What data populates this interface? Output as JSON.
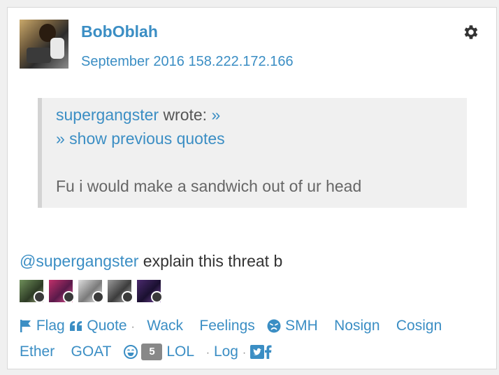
{
  "post": {
    "username": "BobOblah",
    "date": "September 2016",
    "ip": "158.222.172.166",
    "quote": {
      "author": "supergangster",
      "wrote": "wrote:",
      "expand": "»",
      "show_previous": "» show previous quotes",
      "text": "Fu i would make a sandwich out of ur head"
    },
    "mention": "@supergangster",
    "body": "explain this threat b"
  },
  "actions": {
    "flag": "Flag",
    "quote": "Quote",
    "wack": "Wack",
    "feelings": "Feelings",
    "smh": "SMH",
    "nosign": "Nosign",
    "cosign": "Cosign",
    "ether": "Ether",
    "goat": "GOAT",
    "lol_count": "5",
    "lol": "LOL",
    "log": "Log",
    "separator": "·"
  },
  "colors": {
    "link": "#3b8ec4",
    "text": "#333333",
    "quote_bg": "#f0f0f0",
    "count_bg": "#888888"
  },
  "icons": [
    "gear-icon",
    "flag-icon",
    "quote-icon",
    "smh-icon",
    "lol-icon",
    "twitter-icon",
    "facebook-icon"
  ]
}
